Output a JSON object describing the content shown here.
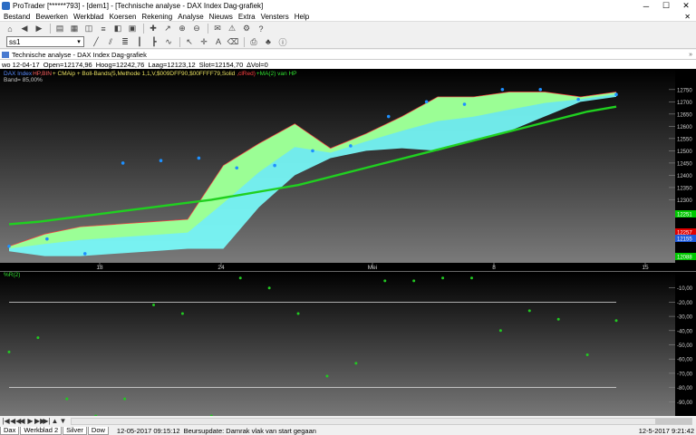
{
  "window": {
    "title": "ProTrader [******793] - [dem1] - [Technische analyse - DAX Index Dag-grafiek]",
    "minimize": "─",
    "maximize": "☐",
    "close": "✕"
  },
  "menu": [
    "Bestand",
    "Bewerken",
    "Werkblad",
    "Koersen",
    "Rekening",
    "Analyse",
    "Nieuws",
    "Extra",
    "Vensters",
    "Help"
  ],
  "menu_close": "✕",
  "toolbar": {
    "combo_value": "ss1",
    "combo_arrow": "▾"
  },
  "chart_window": {
    "title": "Technische analyse - DAX Index Dag-grafiek",
    "chevron": "»"
  },
  "ohlc": {
    "date": "wo 12-04-17",
    "open": "Open=12174,96",
    "high": "Hoog=12242,76",
    "low": "Laag=12123,12",
    "close": "Slot=12154,70",
    "volume": "∆Vol=0"
  },
  "legend_line": {
    "instrument": "DAX Index",
    "style": "HP,BIN",
    "ind1": "+ CMAip + Boll-Bands(5,Methode 1,1,V,$009DFF90,$00FFFF79,Solid",
    "ind2": ",clRed)",
    "ind3": "+MA(2) van HP"
  },
  "band_label": "Band= 85,00%",
  "chart_data": [
    {
      "type": "line",
      "x_tick_labels": [
        "18",
        "24",
        "Mei",
        "8",
        "15"
      ],
      "y_tick_labels": [
        "12750",
        "12700",
        "12650",
        "12600",
        "12550",
        "12500",
        "12450",
        "12400",
        "12350",
        "12300"
      ],
      "ylim": [
        12050,
        12790
      ],
      "series": [
        {
          "values": [
            12110,
            12140,
            12080,
            12450,
            12460,
            12470,
            12430,
            12440,
            12500,
            12520,
            12640,
            12700,
            12690,
            12750,
            12750,
            12710,
            12730
          ]
        },
        {
          "values": [
            12200,
            12210,
            12225,
            12240,
            12255,
            12270,
            12285,
            12300,
            12320,
            12340,
            12360,
            12390,
            12420,
            12450,
            12480,
            12510,
            12540,
            12570,
            12600,
            12630,
            12660,
            12680
          ]
        },
        {
          "upper": [
            12110,
            12160,
            12190,
            12200,
            12210,
            12220,
            12440,
            12530,
            12610,
            12510,
            12570,
            12640,
            12720,
            12720,
            12740,
            12740,
            12720,
            12740
          ],
          "lower": [
            12090,
            12070,
            12070,
            12080,
            12090,
            12100,
            12100,
            12270,
            12400,
            12470,
            12500,
            12510,
            12500,
            12540,
            12580,
            12640,
            12700,
            12720
          ]
        }
      ],
      "markers": [
        "12251",
        "12257",
        "12155",
        "12088"
      ],
      "marker_colors": [
        "#00c800",
        "#e00000",
        "#1e5adc",
        "#00c800"
      ]
    },
    {
      "type": "scatter",
      "title": "%R(2)",
      "y_tick_labels": [
        "-10,00",
        "-20,00",
        "-30,00",
        "-40,00",
        "-50,00",
        "-60,00",
        "-70,00",
        "-80,00",
        "-90,00"
      ],
      "ylim": [
        -100,
        0
      ],
      "hlines": [
        -20,
        -80
      ],
      "values": [
        -55,
        -45,
        -88,
        -100,
        -88,
        -22,
        -28,
        -100,
        -3,
        -10,
        -28,
        -72,
        -63,
        -5,
        -5,
        -3,
        -3,
        -40,
        -26,
        -32,
        -57,
        -33
      ]
    }
  ],
  "nav": {
    "buttons": [
      "|◀",
      "◀◀",
      "◀",
      "▶",
      "▶▶",
      "▶|",
      "▲",
      "▼"
    ]
  },
  "status": {
    "tabs": [
      "Dax",
      "Werkblad 2",
      "Silver",
      "Dow"
    ],
    "timestamp": "12-05-2017 09:15:12",
    "message": "Beursupdate: Damrak vlak van start gegaan",
    "clock": "12-5-2017 9:21:42"
  },
  "colors": {
    "band_green": "#9dff90",
    "band_cyan": "#79ffff",
    "band_edge": "#ff4040",
    "ma_line": "#20d020",
    "price_dot": "#1e90ff",
    "williams_dot": "#22c822",
    "axis_text": "#d0d0d0"
  }
}
